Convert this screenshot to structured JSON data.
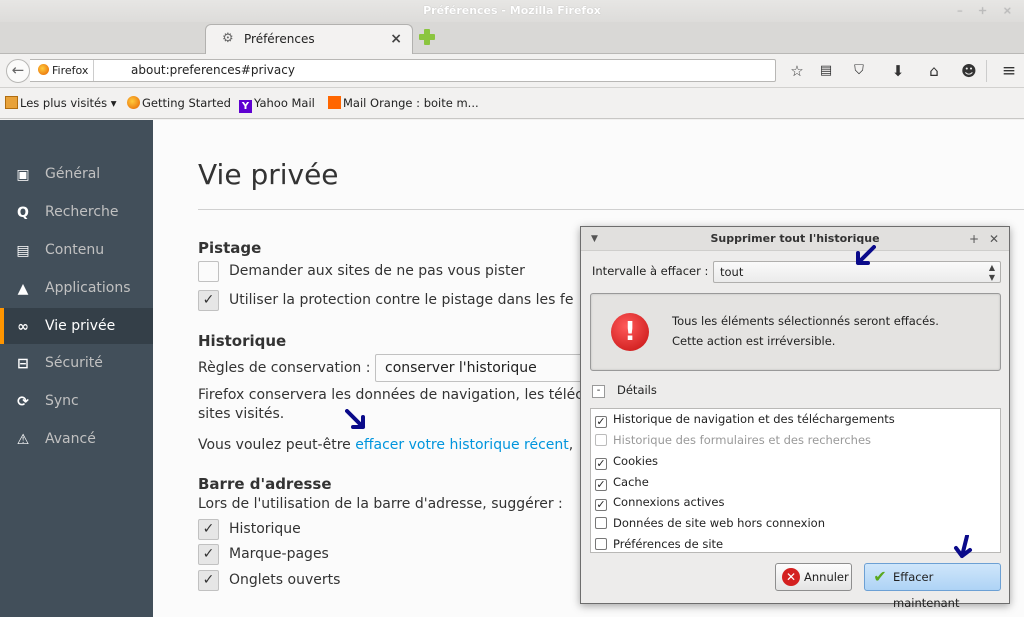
{
  "window": {
    "title": "Préférences - Mozilla Firefox",
    "controls": "– + ×"
  },
  "tab": {
    "title": "Préférences",
    "close": "×"
  },
  "navbar": {
    "identity": "Firefox",
    "url": "about:preferences#privacy"
  },
  "bookmarks": [
    {
      "label": "Les plus visités ▾"
    },
    {
      "label": "Getting Started"
    },
    {
      "label": "Yahoo Mail"
    },
    {
      "label": "Mail Orange : boite m..."
    }
  ],
  "sidebar": {
    "items": [
      {
        "label": "Général",
        "icon": "▣"
      },
      {
        "label": "Recherche",
        "icon": "Q"
      },
      {
        "label": "Contenu",
        "icon": "▤"
      },
      {
        "label": "Applications",
        "icon": "▲"
      },
      {
        "label": "Vie privée",
        "icon": "∞"
      },
      {
        "label": "Sécurité",
        "icon": "⊟"
      },
      {
        "label": "Sync",
        "icon": "⟳"
      },
      {
        "label": "Avancé",
        "icon": "⚠"
      }
    ]
  },
  "main": {
    "title": "Vie privée",
    "tracking": {
      "heading": "Pistage",
      "option1": "Demander aux sites de ne pas vous pister",
      "option2": "Utiliser la protection contre le pistage dans les fe"
    },
    "history": {
      "heading": "Historique",
      "rules_label": "Règles de conservation :",
      "rules_value": "conserver l'historique",
      "desc_line1": "Firefox conservera les données de navigation, les téléc",
      "desc_line2": "sites visités.",
      "maybe_prefix": "Vous voulez peut-être ",
      "maybe_link": "effacer votre historique récent",
      "maybe_suffix": ","
    },
    "addressbar": {
      "heading": "Barre d'adresse",
      "desc": "Lors de l'utilisation de la barre d'adresse, suggérer :",
      "opt1": "Historique",
      "opt2": "Marque-pages",
      "opt3": "Onglets ouverts"
    }
  },
  "dialog": {
    "title": "Supprimer tout l'historique",
    "range_label": "Intervalle à effacer :",
    "range_value": "tout",
    "warning_line1": "Tous les éléments sélectionnés seront effacés.",
    "warning_line2": "Cette action est irréversible.",
    "details_label": "Détails",
    "details": [
      {
        "label": "Historique de navigation et des téléchargements",
        "checked": true,
        "disabled": false
      },
      {
        "label": "Historique des formulaires et des recherches",
        "checked": false,
        "disabled": true
      },
      {
        "label": "Cookies",
        "checked": true,
        "disabled": false
      },
      {
        "label": "Cache",
        "checked": true,
        "disabled": false
      },
      {
        "label": "Connexions actives",
        "checked": true,
        "disabled": false
      },
      {
        "label": "Données de site web hors connexion",
        "checked": false,
        "disabled": false
      },
      {
        "label": "Préférences de site",
        "checked": false,
        "disabled": false
      }
    ],
    "cancel": "Annuler",
    "clear_now": "Effacer maintenant"
  },
  "colors": {
    "sidebar_bg": "#424f5a",
    "sidebar_selected": "#343f48",
    "accent": "#ff9500",
    "link": "#0095dd",
    "annotation_arrow": "#0a0a8a"
  }
}
